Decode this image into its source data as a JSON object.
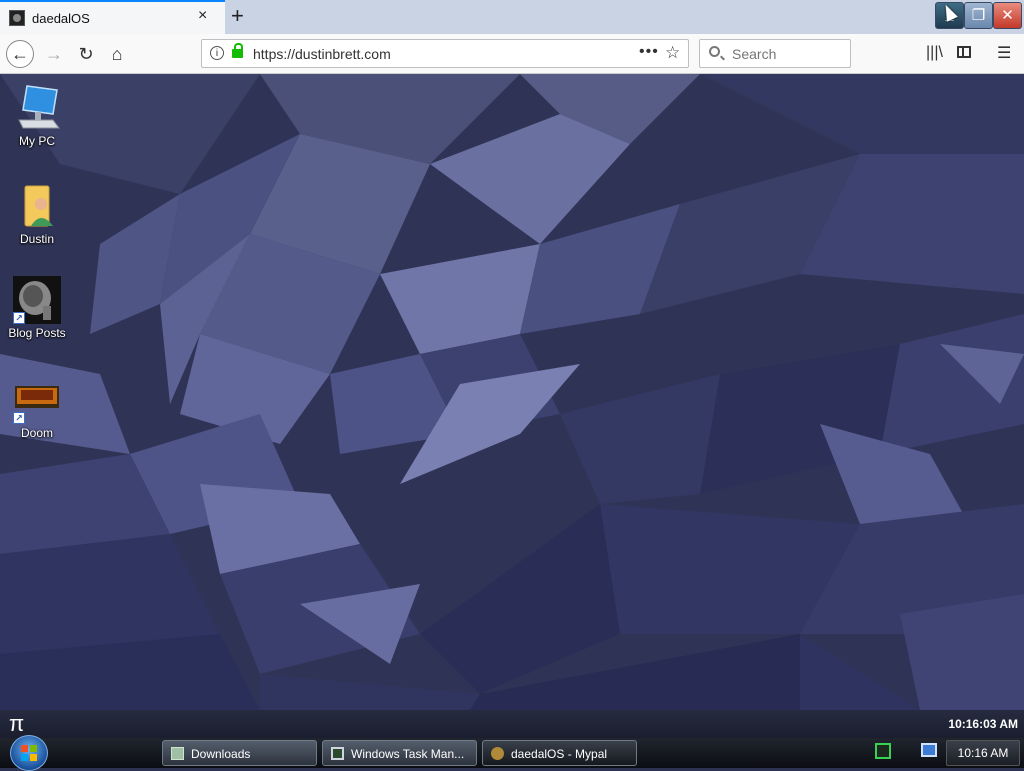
{
  "browser": {
    "tab_title": "daedalOS",
    "url": "https://dustinbrett.com",
    "search_placeholder": "Search",
    "new_tab_label": "+",
    "close_tab_label": "×"
  },
  "desktop_icons": [
    {
      "label": "My PC",
      "icon": "computer-icon"
    },
    {
      "label": "Dustin",
      "icon": "user-folder-icon"
    },
    {
      "label": "Blog Posts",
      "icon": "brain-scan-icon"
    },
    {
      "label": "Doom",
      "icon": "doom-icon"
    }
  ],
  "pibar": {
    "pi_symbol": "π",
    "clock": "10:16:03 AM"
  },
  "taskbar": {
    "items": [
      {
        "label": "Downloads",
        "icon": "folder-icon"
      },
      {
        "label": "Windows Task Man...",
        "icon": "task-manager-icon"
      },
      {
        "label": "daedalOS - Mypal",
        "icon": "mypal-browser-icon",
        "active": true
      }
    ],
    "clock": "10:16 AM"
  },
  "colors": {
    "accent": "#0a84ff",
    "lock_green": "#12bc00",
    "desktop_base": "#2f3456"
  }
}
